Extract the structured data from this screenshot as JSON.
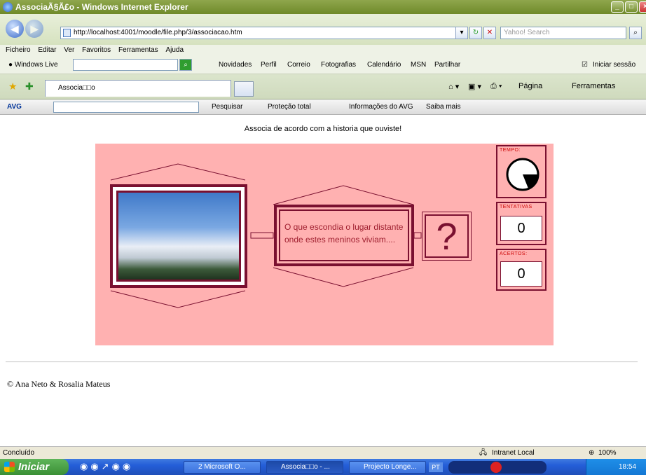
{
  "window": {
    "title": "AssociaÃ§Ã£o - Windows Internet Explorer"
  },
  "address": {
    "url": "http://localhost:4001/moodle/file.php/3/associacao.htm",
    "search_placeholder": "Yahoo! Search"
  },
  "menu": [
    "Ficheiro",
    "Editar",
    "Ver",
    "Favoritos",
    "Ferramentas",
    "Ajuda"
  ],
  "livebar": {
    "brand": "Windows Live",
    "links": [
      "Novidades",
      "Perfil",
      "Correio",
      "Fotografias",
      "Calendário",
      "MSN",
      "Partilhar"
    ],
    "signin": "Iniciar sessão"
  },
  "tab": {
    "title": "Associa□□o",
    "tools": [
      "Página",
      "Ferramentas"
    ]
  },
  "avg": {
    "brand": "AVG",
    "search": "Pesquisar",
    "protection": "Proteção total",
    "info": "Informações do AVG",
    "more": "Saiba mais"
  },
  "page": {
    "heading": "Associa de acordo com a historia que ouviste!",
    "question": "O que escondia o lugar distante onde estes meninos viviam....",
    "question_mark": "?",
    "timer_label": "TEMPO:",
    "tries_label": "TENTATIVAS",
    "tries_value": "0",
    "hits_label": "ACERTOS:",
    "hits_value": "0",
    "copyright": "© Ana Neto & Rosalia Mateus"
  },
  "status": {
    "text": "Concluído",
    "zone": "Intranet Local",
    "zoom": "100%"
  },
  "taskbar": {
    "start": "Iniciar",
    "tasks": [
      "2 Microsoft O...",
      "Associa□□o - ...",
      "Projecto Longe..."
    ],
    "lang": "PT",
    "clock": "18:54"
  },
  "colors": {
    "stage": "#ffb1b1",
    "frame": "#7a1030",
    "titlebar": "#7a9330",
    "taskbar": "#245ed8"
  }
}
